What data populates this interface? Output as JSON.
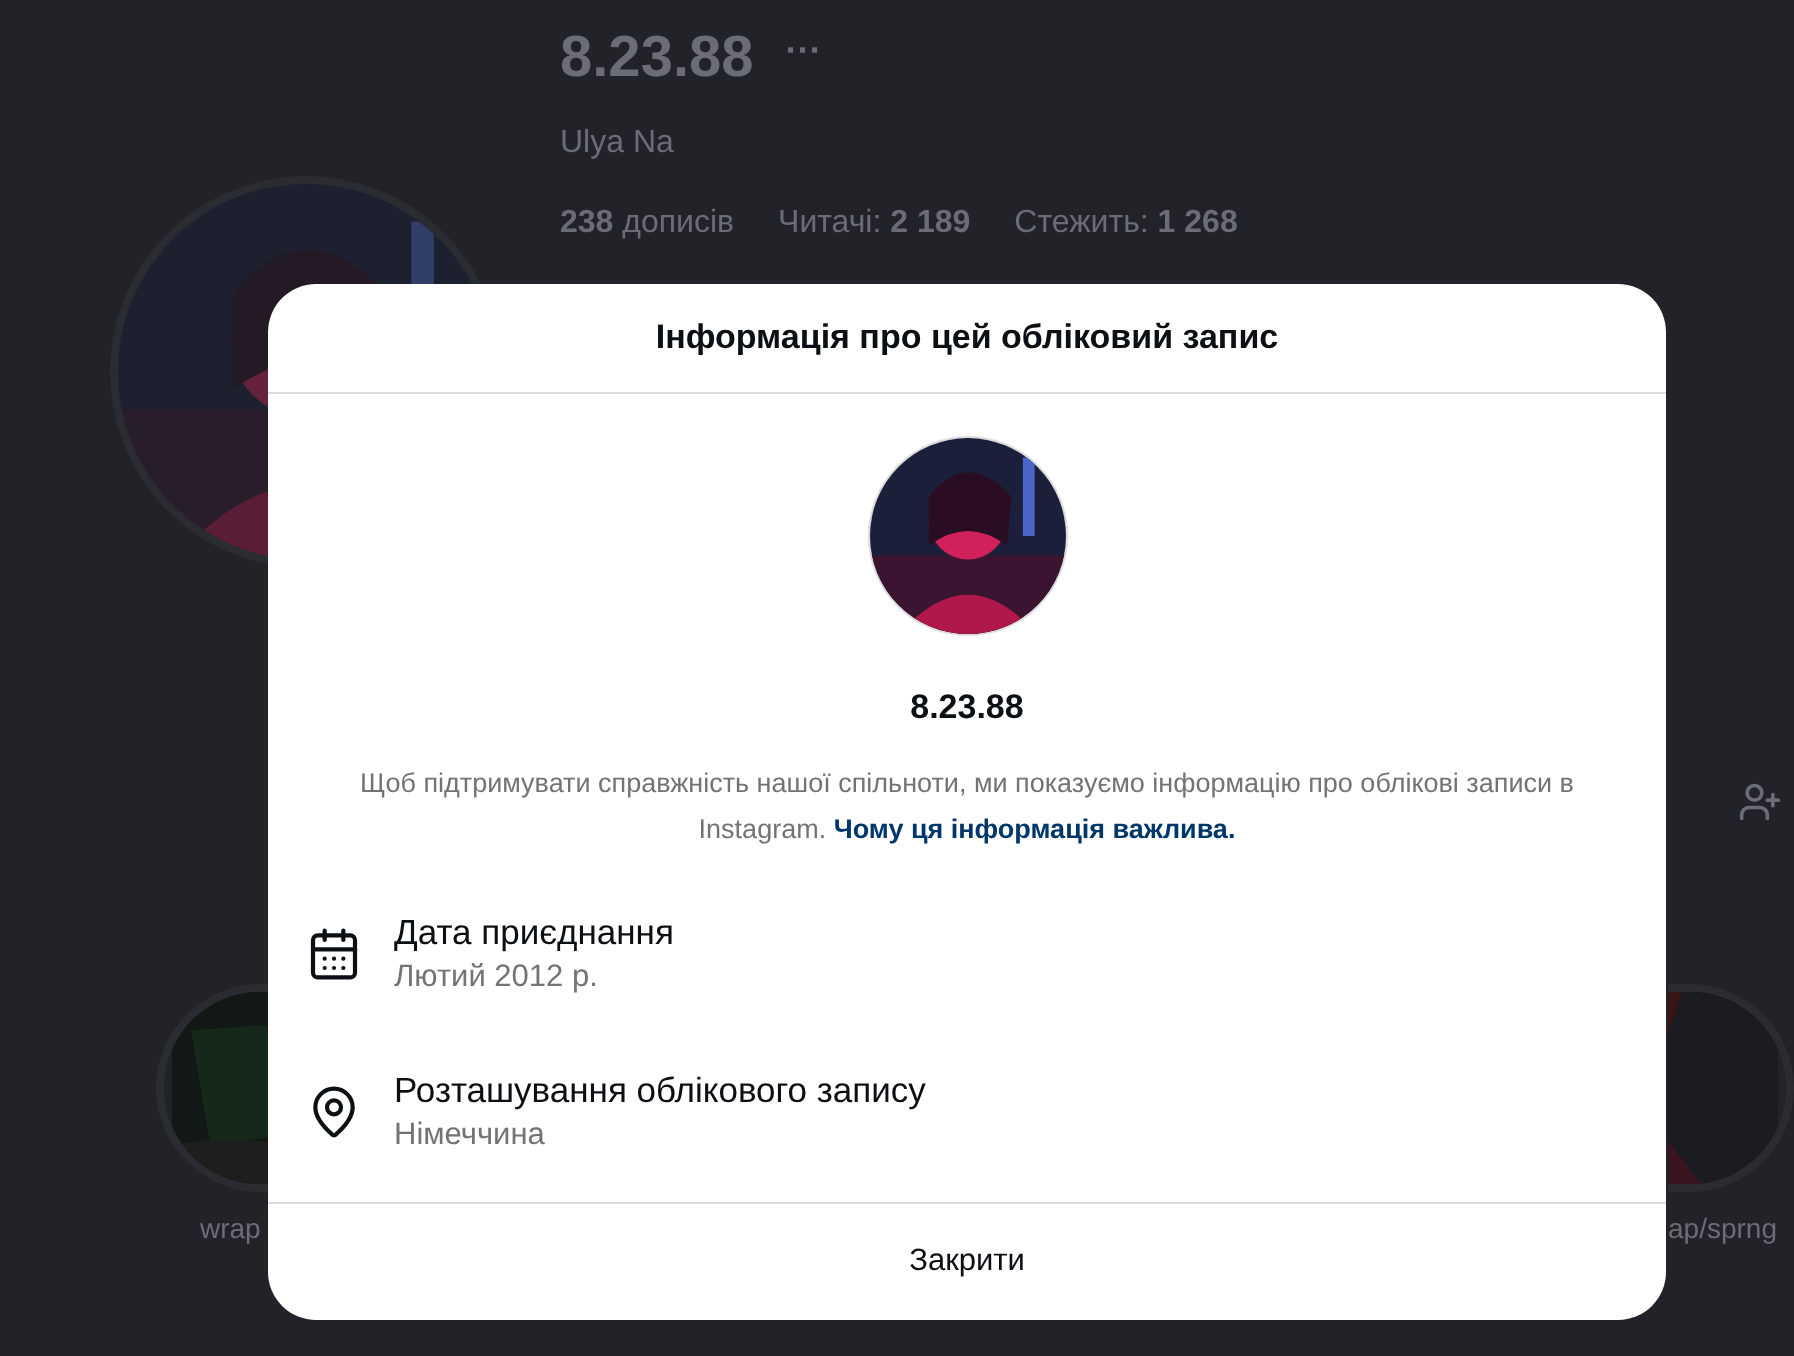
{
  "profile": {
    "username": "8.23.88",
    "more": "···",
    "full_name": "Ulya Na",
    "stats": [
      "**238** дописів",
      "Читачі: **2 189**",
      "Стежить: **1 268**"
    ]
  },
  "highlights": [
    {
      "label": "wrap"
    },
    {
      "label": "ap/sprng"
    }
  ],
  "dialog": {
    "title": "Інформація про цей обліковий запис",
    "username": "8.23.88",
    "description": "Щоб підтримувати справжність нашої спільноти, ми показуємо інформацію про облікові записи в Instagram.",
    "link": "Чому ця інформація важлива.",
    "items": [
      {
        "kind": "date",
        "title": "Дата приєднання",
        "value": "Лютий 2012 р."
      },
      {
        "kind": "location",
        "title": "Розташування облікового запису",
        "value": "Німеччина"
      }
    ],
    "close": "Закрити"
  }
}
